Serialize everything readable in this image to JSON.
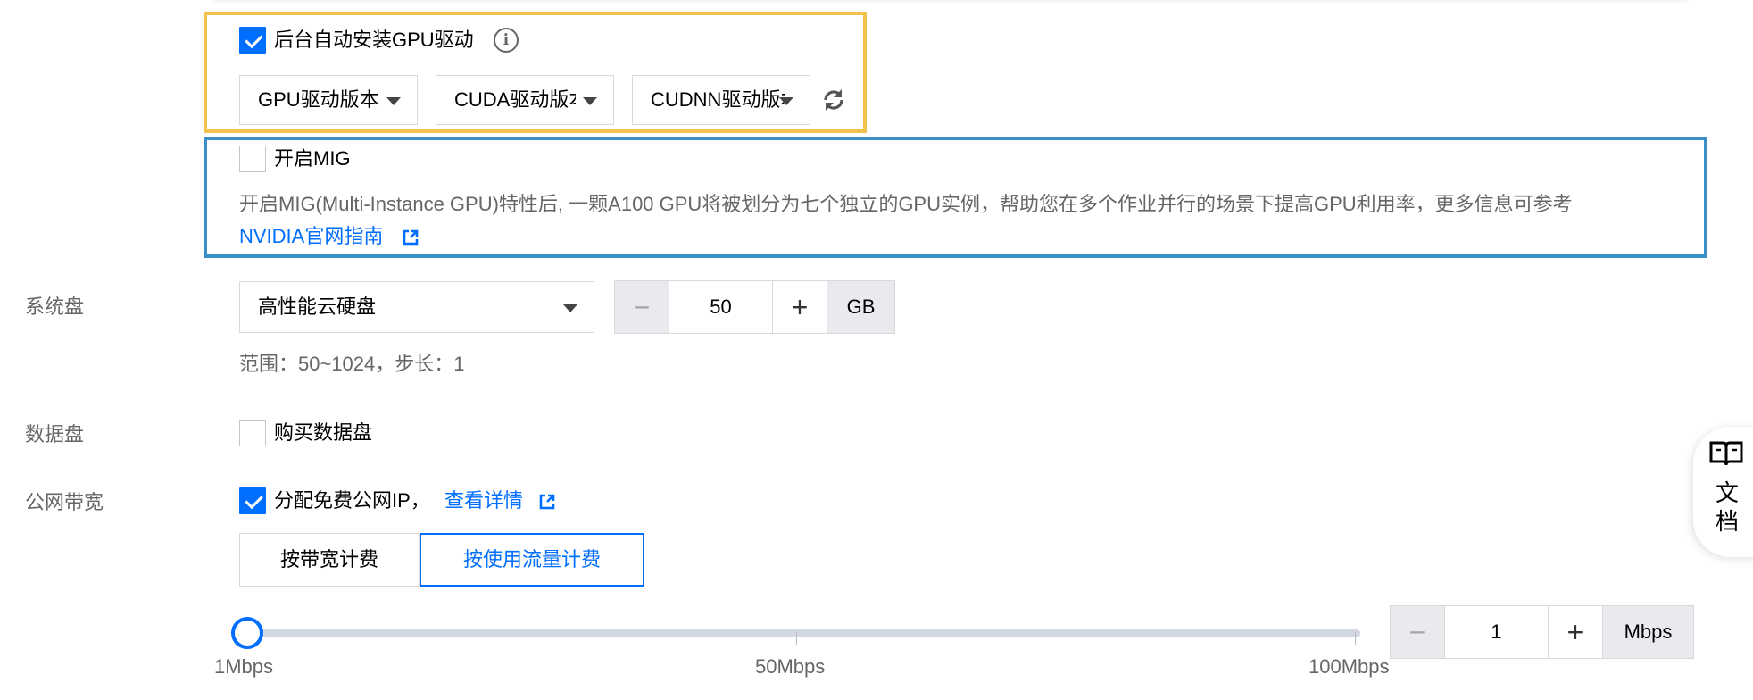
{
  "gpu_driver": {
    "auto_install_label": "后台自动安装GPU驱动",
    "auto_install_checked": true,
    "gpu_driver_select": "GPU驱动版本",
    "cuda_select": "CUDA驱动版本",
    "cudnn_select": "CUDNN驱动版本"
  },
  "mig": {
    "label": "开启MIG",
    "checked": false,
    "description": "开启MIG(Multi-Instance GPU)特性后, 一颗A100 GPU将被划分为七个独立的GPU实例，帮助您在多个作业并行的场景下提高GPU利用率，更多信息可参考",
    "link": "NVIDIA官网指南"
  },
  "system_disk": {
    "label": "系统盘",
    "type": "高性能云硬盘",
    "size": "50",
    "unit": "GB",
    "hint": "范围：50~1024，步长：1"
  },
  "data_disk": {
    "label": "数据盘",
    "buy_label": "购买数据盘",
    "checked": false
  },
  "bandwidth": {
    "label": "公网带宽",
    "free_ip_label": "分配免费公网IP，",
    "free_ip_checked": true,
    "details_link": "查看详情",
    "tabs": [
      "按带宽计费",
      "按使用流量计费"
    ],
    "active_tab": 1,
    "slider": {
      "min_label": "1Mbps",
      "mid_label": "50Mbps",
      "max_label": "100Mbps",
      "value": 1,
      "min": 1,
      "max": 100
    },
    "value": "1",
    "unit": "Mbps"
  },
  "docs": {
    "line1": "文",
    "line2": "档"
  },
  "colors": {
    "accent": "#006eff",
    "highlight_yellow": "#f2c14e",
    "highlight_blue": "#3a8ec9"
  }
}
